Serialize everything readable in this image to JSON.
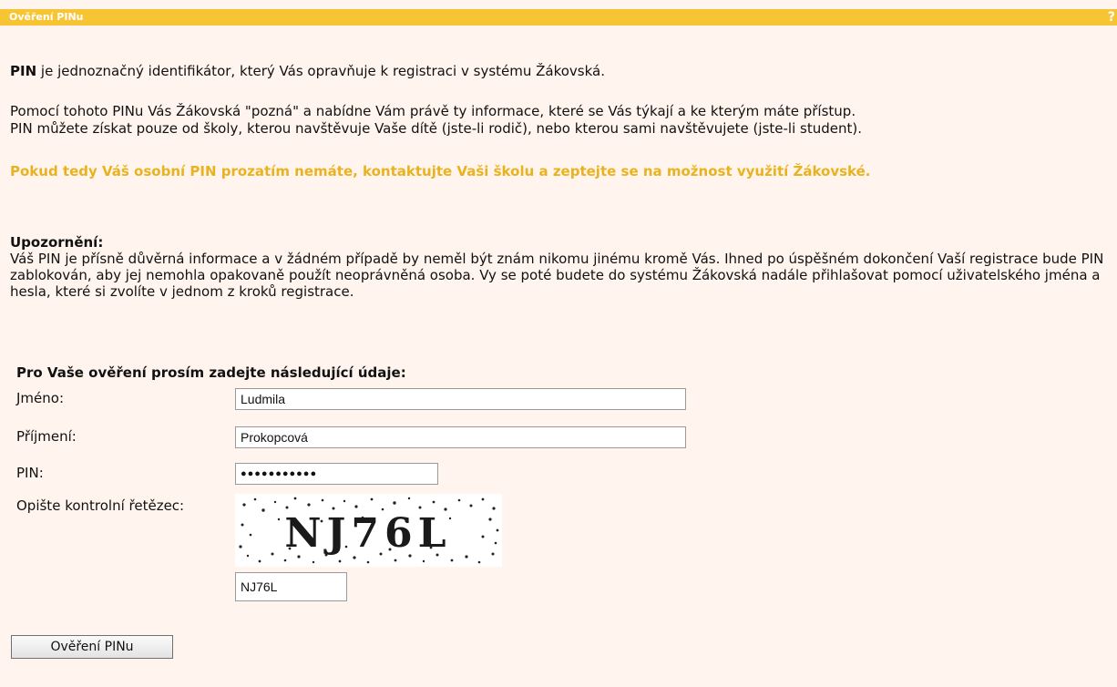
{
  "window": {
    "title": "Ověření PINu",
    "help_label": "?"
  },
  "intro": {
    "pin_word": "PIN",
    "text": " je jednoznačný identifikátor, který Vás opravňuje k registraci v systému Žákovská."
  },
  "info": {
    "line1": "Pomocí tohoto PINu Vás Žákovská \"pozná\" a nabídne Vám právě ty informace, které se Vás týkají a ke kterým máte přístup.",
    "line2": "PIN můžete získat pouze od školy, kterou navštěvuje Vaše dítě (jste-li rodič), nebo kterou sami navštěvujete (jste-li student)."
  },
  "highlight": "Pokud tedy Váš osobní PIN prozatím nemáte, kontaktujte Vaši školu a zeptejte se na možnost využití Žákovské.",
  "notice": {
    "title": "Upozornění:",
    "text": "Váš PIN je přísně důvěrná informace a v žádném případě by neměl být znám nikomu jinému kromě Vás. Ihned po úspěšném dokončení Vaší registrace bude PIN zablokován, aby jej nemohla opakovaně použít neoprávněná osoba. Vy se poté budete do systému Žákovská nadále přihlašovat pomocí uživatelského jména a hesla, které si zvolíte v jednom z kroků registrace."
  },
  "form": {
    "heading": "Pro Vaše ověření prosím zadejte následující údaje:",
    "first_name_label": "Jméno:",
    "first_name_value": "Ludmila",
    "last_name_label": "Příjmení:",
    "last_name_value": "Prokopcová",
    "pin_label": "PIN:",
    "pin_value": "●●●●●●●●●●●",
    "captcha_label": "Opište kontrolní řetězec:",
    "captcha_text": "NJ76L",
    "captcha_input_value": "NJ76L",
    "submit_label": "Ověření PINu"
  },
  "colors": {
    "titlebar": "#f7c533",
    "background": "#fff4ee",
    "highlight": "#e9b320"
  }
}
